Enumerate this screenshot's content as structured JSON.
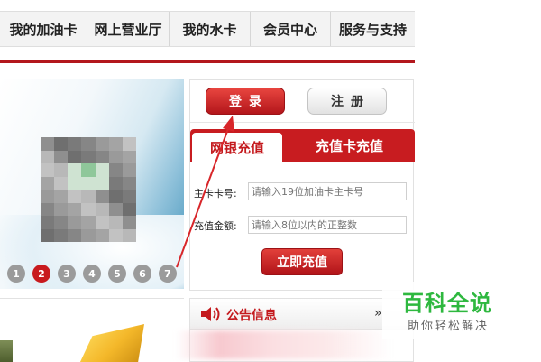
{
  "nav": {
    "items": [
      "我的加油卡",
      "网上营业厅",
      "我的水卡",
      "会员中心",
      "服务与支持"
    ]
  },
  "banner": {
    "slides": [
      "1",
      "2",
      "3",
      "4",
      "5",
      "6",
      "7"
    ],
    "active_slide": 2
  },
  "account": {
    "login_label": "登录",
    "register_label": "注册"
  },
  "recharge": {
    "tabs": [
      "网银充值",
      "充值卡充值"
    ],
    "active_tab": "网银充值",
    "card_label": "主卡卡号:",
    "card_placeholder": "请输入19位加油卡主卡号",
    "amount_label": "充值金额:",
    "amount_placeholder": "请输入8位以内的正整数",
    "submit_label": "立即充值"
  },
  "notice": {
    "title": "公告信息",
    "more": "»"
  },
  "watermark": {
    "logo": "百科全说",
    "tagline": "助你轻松解决"
  },
  "colors": {
    "brand_red": "#c81c20",
    "watermark_green": "#2eb83f"
  },
  "icons": [
    "speaker-icon",
    "arrow-annotation"
  ]
}
